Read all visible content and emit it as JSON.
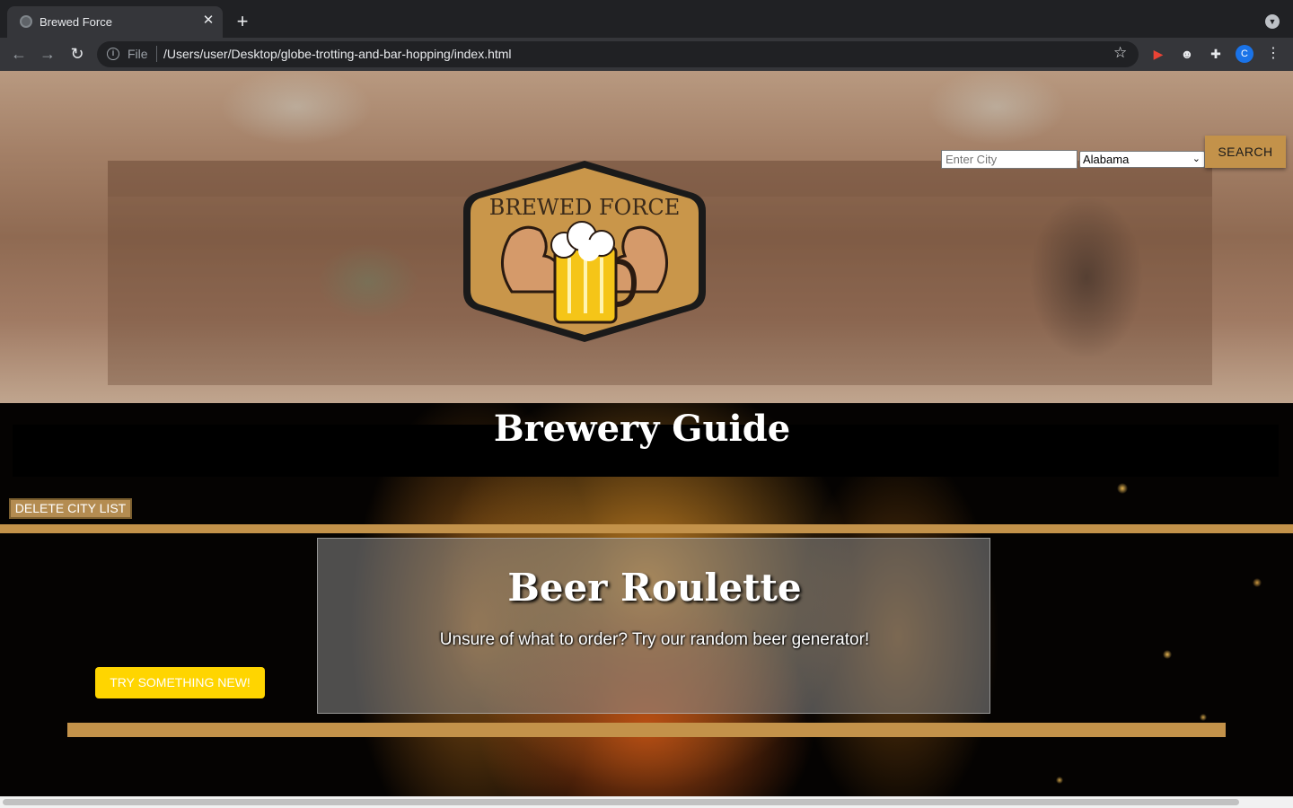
{
  "browser": {
    "tab_title": "Brewed Force",
    "new_tab_glyph": "+",
    "url_scheme": "File",
    "url": "/Users/user/Desktop/globe-trotting-and-bar-hopping/index.html",
    "profile_initial": "C"
  },
  "search": {
    "city_placeholder": "Enter City",
    "state_selected": "Alabama",
    "button_label": "SEARCH"
  },
  "logo": {
    "text": "BREWED FORCE"
  },
  "brewery": {
    "title": "Brewery Guide",
    "delete_label": "DELETE CITY LIST"
  },
  "roulette": {
    "title": "Beer Roulette",
    "subtitle": "Unsure of what to order? Try our random beer generator!",
    "button_label": "TRY SOMETHING NEW!"
  },
  "colors": {
    "gold": "#c3924a",
    "yellow_button": "#ffd500",
    "chrome_dark": "#202124",
    "chrome_toolbar": "#35363a"
  }
}
